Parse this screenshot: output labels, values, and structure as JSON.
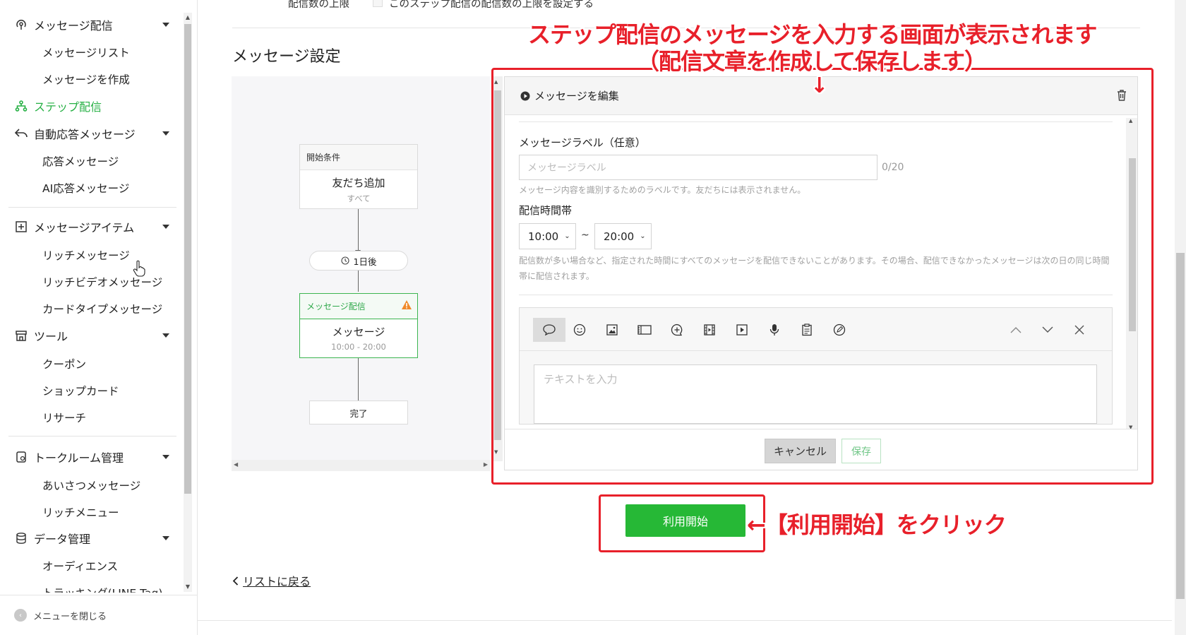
{
  "sidebar": {
    "groups": [
      {
        "label": "メッセージ配信",
        "icon": "broadcast-icon",
        "items": [
          "メッセージリスト",
          "メッセージを作成"
        ]
      },
      {
        "label": "ステップ配信",
        "icon": "step-tree-icon"
      },
      {
        "label": "自動応答メッセージ",
        "icon": "reply-arrow-icon",
        "items": [
          "応答メッセージ",
          "AI応答メッセージ"
        ]
      },
      {
        "label": "メッセージアイテム",
        "icon": "plus-square-icon",
        "items": [
          "リッチメッセージ",
          "リッチビデオメッセージ",
          "カードタイプメッセージ"
        ]
      },
      {
        "label": "ツール",
        "icon": "shop-icon",
        "items": [
          "クーポン",
          "ショップカード",
          "リサーチ"
        ]
      },
      {
        "label": "トークルーム管理",
        "icon": "chat-settings-icon",
        "items": [
          "あいさつメッセージ",
          "リッチメニュー"
        ]
      },
      {
        "label": "データ管理",
        "icon": "database-icon",
        "items": [
          "オーディエンス",
          "トラッキング(LINE Tag)"
        ]
      }
    ],
    "close_label": "メニューを閉じる"
  },
  "top": {
    "limit_label": "配信数の上限",
    "limit_checkbox_label": "このステップ配信の配信数の上限を設定する"
  },
  "section_title": "メッセージ設定",
  "flow": {
    "start": {
      "header": "開始条件",
      "title": "友だち追加",
      "sub": "すべて"
    },
    "delay": "1日後",
    "message": {
      "header": "メッセージ配信",
      "title": "メッセージ",
      "sub": "10:00 - 20:00"
    },
    "end": "完了"
  },
  "modal": {
    "title": "メッセージを編集",
    "label_field": {
      "label": "メッセージラベル（任意）",
      "placeholder": "メッセージラベル",
      "counter": "0/20",
      "hint": "メッセージ内容を識別するためのラベルです。友だちには表示されません。"
    },
    "time_field": {
      "label": "配信時間帯",
      "from": "10:00",
      "sep": "~",
      "to": "20:00",
      "hint": "配信数が多い場合など、指定された時間にすべてのメッセージを配信できないことがあります。その場合、配信できなかったメッセージは次の日の同じ時間帯に配信されます。"
    },
    "toolbar_icons": [
      "text-bubble-icon",
      "emoji-icon",
      "image-icon",
      "card-icon",
      "sticker-bubble-icon",
      "video-icon",
      "rich-video-icon",
      "mic-icon",
      "coupon-icon",
      "research-icon"
    ],
    "text_placeholder": "テキストを入力",
    "cancel_label": "キャンセル",
    "save_label": "保存"
  },
  "start_button_label": "利用開始",
  "back_link_label": "リストに戻る",
  "annotations": {
    "line1": "ステップ配信のメッセージを入力する画面が表示されます",
    "line2": "（配信文章を作成して保存します）",
    "down_arrow": "↓",
    "click_note": "←【利用開始】をクリック"
  },
  "colors": {
    "accent_green": "#26b836",
    "annotation_red": "#e8202a",
    "warning_orange": "#f08a2a"
  }
}
